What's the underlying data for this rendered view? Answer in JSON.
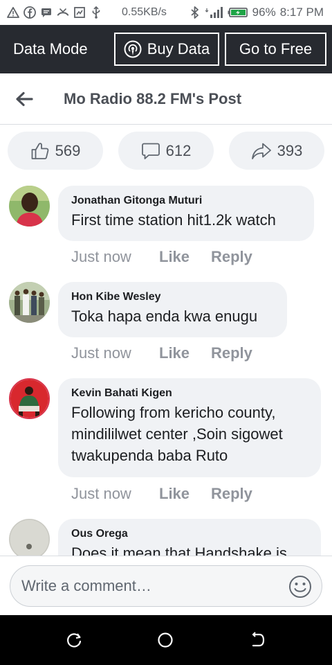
{
  "status_bar": {
    "speed": "0.55KB/s",
    "battery": "96%",
    "time": "8:17 PM",
    "icons": [
      "warning-icon",
      "facebook-icon",
      "message-icon",
      "missed-call-icon",
      "screenshot-icon",
      "usb-icon",
      "bluetooth-icon",
      "signal-icon",
      "battery-icon"
    ]
  },
  "data_mode": {
    "label": "Data Mode",
    "buy_label": "Buy Data",
    "free_label": "Go to Free"
  },
  "header": {
    "title": "Mo Radio 88.2 FM's Post"
  },
  "reactions": {
    "likes": "569",
    "comments": "612",
    "shares": "393"
  },
  "comments": [
    {
      "name": "Jonathan Gitonga Muturi",
      "lines": [
        "First time station hit1.2k watch"
      ],
      "time": "Just now",
      "like": "Like",
      "reply": "Reply"
    },
    {
      "name": "Hon Kibe Wesley",
      "lines": [
        "Toka hapa enda kwa enugu"
      ],
      "time": "Just now",
      "like": "Like",
      "reply": "Reply"
    },
    {
      "name": "Kevin Bahati Kigen",
      "lines": [
        "Following from kericho county,",
        "mindililwet center ,Soin sigowet",
        "twakupenda baba Ruto"
      ],
      "time": "Just now",
      "like": "Like",
      "reply": "Reply"
    },
    {
      "name": "Ous Orega",
      "lines": [
        "Does it mean that Handshake is"
      ],
      "time": "",
      "like": "",
      "reply": ""
    }
  ],
  "composer": {
    "placeholder": "Write a comment…"
  },
  "colors": {
    "data_bar": "#272a30",
    "bubble": "#f0f2f5",
    "meta_text": "#90949c"
  }
}
